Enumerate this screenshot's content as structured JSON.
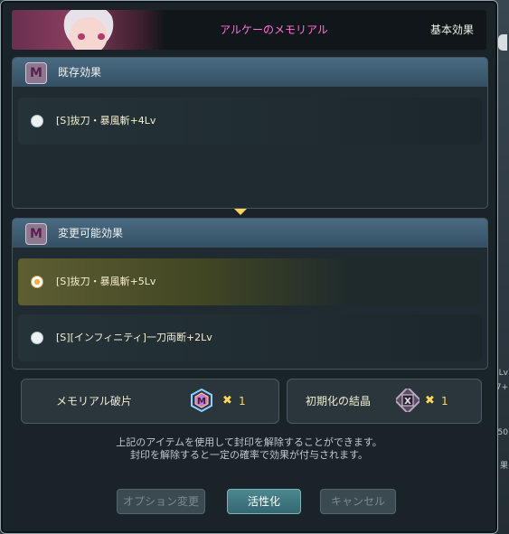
{
  "header": {
    "title": "アルケーのメモリアル",
    "right_label": "基本効果"
  },
  "side_text": [
    "Lv",
    "7+",
    "50",
    "果"
  ],
  "existing_panel": {
    "title": "既存効果",
    "options": [
      {
        "label": "[S]抜刀・暴風斬+4Lv",
        "selected": false
      }
    ]
  },
  "changeable_panel": {
    "title": "変更可能効果",
    "options": [
      {
        "label": "[S]抜刀・暴風斬+5Lv",
        "selected": true
      },
      {
        "label": "[S][インフィニティ]一刀両断+2Lv",
        "selected": false
      }
    ]
  },
  "costs": [
    {
      "label": "メモリアル破片",
      "icon": "memorial-fragment-icon",
      "multiplier": "✖",
      "quantity": "1"
    },
    {
      "label": "初期化の結晶",
      "icon": "reset-crystal-icon",
      "multiplier": "✖",
      "quantity": "1"
    }
  ],
  "info": {
    "line1": "上記のアイテムを使用して封印を解除することができます。",
    "line2": "封印を解除すると一定の確率で効果が付与されます。"
  },
  "buttons": {
    "option_change": "オプション変更",
    "activate": "活性化",
    "cancel": "キャンセル"
  },
  "colors": {
    "title_pink": "#ff70d6",
    "accent_gold": "#ffd85a",
    "panel_header": "#496b83"
  }
}
